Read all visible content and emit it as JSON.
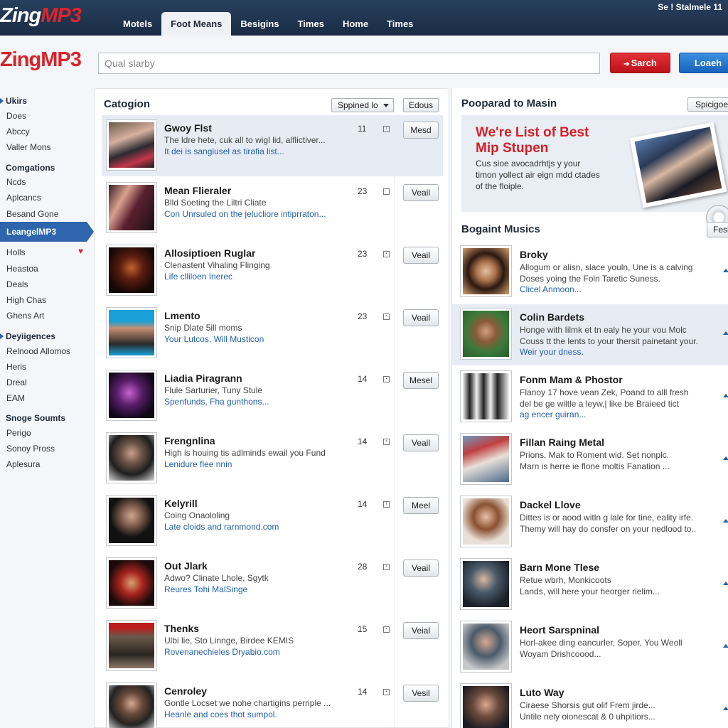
{
  "header": {
    "logo_white": "Zing",
    "logo_red": "MP3",
    "brand": "ZingMP3",
    "user": "Se ! Stalmele 11",
    "tabs": [
      "Motels",
      "Foot Means",
      "Besigins",
      "Times",
      "Home",
      "Times"
    ],
    "active_tab": 1,
    "search_placeholder": "Qual slarby",
    "search_button": "Sarch",
    "load_button": "Loaeh"
  },
  "sidebar": {
    "section1": "Ukirs",
    "items1": [
      "Does",
      "Abccy",
      "Valler Mons"
    ],
    "section2": "Comgations",
    "items2": [
      "Ncds",
      "Aplcancs",
      "Besand Gone"
    ],
    "active": "LeangelMP3",
    "items3": [
      "Holls",
      "Heastoa",
      "Deals",
      "High Chas",
      "Ghens Art"
    ],
    "section3": "Deyiigences",
    "items4": [
      "Relnood Allomos",
      "Heris",
      "Dreal",
      "EAM"
    ],
    "section4": "Snoge Soumts",
    "items5": [
      "Perigo",
      "Sonoy Pross",
      "Aplesura"
    ]
  },
  "category": {
    "title": "Catogion",
    "sort_label": "Sppined lo",
    "edit_label": "Edous",
    "rows": [
      {
        "title": "Gwoy Flst",
        "desc": "The ldre hete, cuk all to wigl lid, alflictiver...",
        "link": "It dei is sangiusel as tirafia list...",
        "num": "11",
        "btn": "Mesd"
      },
      {
        "title": "Mean Flieraler",
        "desc": "Blld Soeting the Liltri Cliate",
        "link": "Con Unrsuled on the jelucliore intiprraton...",
        "num": "23",
        "btn": "Veail"
      },
      {
        "title": "Allosiptioen Ruglar",
        "desc": "Clenastent Vihaling Flinging",
        "link": "Life clliloen Inerec",
        "num": "23",
        "btn": "Veail"
      },
      {
        "title": "Lmento",
        "desc": "Snip Dlate 5ill moms",
        "link": "Your Lutcos, Will Musticon",
        "num": "23",
        "btn": "Veail"
      },
      {
        "title": "Liadia Piragrann",
        "desc": "Flule Sarturier, Tuny Stule",
        "link": "Spenfunds, Fha gunthons...",
        "num": "14",
        "btn": "Mesel"
      },
      {
        "title": "Frengnlina",
        "desc": "High is houing tis adlminds ewail you Fund",
        "link": "Lenidure flee nnin",
        "num": "14",
        "btn": "Veail"
      },
      {
        "title": "Kelyrill",
        "desc": "Coing Onaololing",
        "link": "Late cloids and rarnmond.com",
        "num": "14",
        "btn": "Meel"
      },
      {
        "title": "Out Jlark",
        "desc": "Adwo? Clinate Lhole, Sgytk",
        "link": "Reures Tohi MalSinge",
        "num": "28",
        "btn": "Veail"
      },
      {
        "title": "Thenks",
        "desc": "Ulbi lie, Sto Linnge, Birdee KEMIS",
        "link": "Rovenanechieles Dryabio.com",
        "num": "15",
        "btn": "Veial"
      },
      {
        "title": "Cenroley",
        "desc": "Gontle Locset we nohe chartigins perriple ...",
        "link": "Heanle and coes thot sumpol.",
        "num": "14",
        "btn": "Vesil"
      }
    ]
  },
  "right": {
    "title": "Pooparad to Masin",
    "btn": "Spicigoef",
    "promo_title_1": "We're List of Best",
    "promo_title_2": "Mip Stupen",
    "promo_text": "Cus sioe avocadrhtjs y your timon yollect air eign mdd ctades of the floiple.",
    "section": "Bogaint Musics",
    "section_btn": "Fesi",
    "rows": [
      {
        "title": "Broky",
        "desc1": "Allogum or alisn, slace youln, Une is a calving",
        "desc2": "Doses yoing the Foln Taretic Suness.",
        "link": "Clicel Anmoon..."
      },
      {
        "title": "Colin Bardets",
        "desc1": "Honge with Iilmk et tn ealy he your vou Molc",
        "desc2": "Couss tt the lents to your thersit painetant your.",
        "link": "Weir your dness."
      },
      {
        "title": "Fonm Mam & Phostor",
        "desc1": "Flanoy 17 hove vean Zek, Poand to alll fresh",
        "desc2": "del be ge wiltle a leyw,| like be Braieed tict",
        "link": "ag encer guiran..."
      },
      {
        "title": "Fillan Raing Metal",
        "desc1": "Prions, Mak to Roment wid. Set nonplc.",
        "desc2": "Marn is herre ie flone moltis Fanation ...",
        "link": ""
      },
      {
        "title": "Dackel Llove",
        "desc1": "Dittes is or aood witln g lale for tine, eality irfe.",
        "desc2": "Themy will hay do consfer on your nedlood to..",
        "link": ""
      },
      {
        "title": "Barn Mone Tlese",
        "desc1": "Retue wbrh, Monkicoots",
        "desc2": "Lands, will here your heorger rielim...",
        "link": ""
      },
      {
        "title": "Heort Sarspninal",
        "desc1": "Horl-akee ding eancurler, Soper, You Weoll",
        "desc2": "Woyam Drishcoood...",
        "link": ""
      },
      {
        "title": "Luto Way",
        "desc1": "Ciraese Shorsis gut olif Frem jirde...",
        "desc2": "Untile nely oionescat & 0 uhpitiors...",
        "link": ""
      }
    ]
  }
}
